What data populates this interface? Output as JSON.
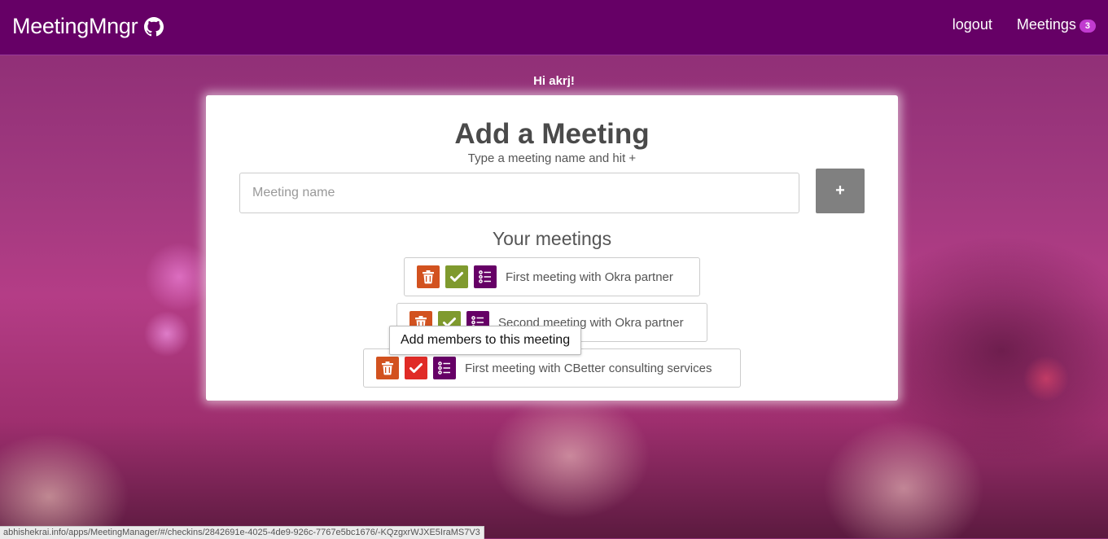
{
  "navbar": {
    "brand": "MeetingMngr",
    "logout_label": "logout",
    "meetings_label": "Meetings",
    "meetings_count": "3"
  },
  "greeting": "Hi akrj!",
  "form": {
    "title": "Add a Meeting",
    "subtitle": "Type a meeting name and hit +",
    "input_placeholder": "Meeting name",
    "input_value": "",
    "add_label": "+"
  },
  "list": {
    "heading": "Your meetings",
    "items": [
      {
        "name": "First meeting with Okra partner"
      },
      {
        "name": "Second meeting with Okra partner"
      },
      {
        "name": "First meeting with CBetter consulting services"
      }
    ]
  },
  "tooltip": "Add members to this meeting",
  "status_url": "abhishekrai.info/apps/MeetingManager/#/checkins/2842691e-4025-4de9-926c-7767e5bc1676/-KQzgxrWJXE5IraMS7V3",
  "colors": {
    "navbar": "#660066",
    "delete": "#d2521f",
    "check_green": "#7f9a2e",
    "check_red": "#e02b26",
    "list": "#660066",
    "badge": "#c13bd0"
  },
  "icons": [
    "github-icon",
    "trash-icon",
    "check-icon",
    "list-icon"
  ]
}
